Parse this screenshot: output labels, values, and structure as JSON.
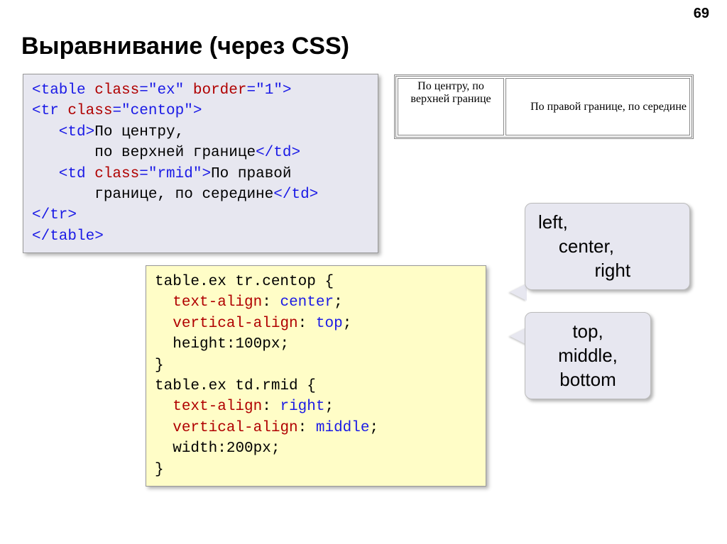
{
  "page_number": "69",
  "title": "Выравнивание (через CSS)",
  "html_code": {
    "l1": {
      "a": "<table ",
      "b": "class",
      "c": "=",
      "d": "\"ex\"",
      "e": " ",
      "f": "border",
      "g": "=",
      "h": "\"1\"",
      "i": ">"
    },
    "l2": {
      "a": "<tr ",
      "b": "class",
      "c": "=",
      "d": "\"centop\"",
      "e": ">"
    },
    "l3": {
      "a": "   <td>",
      "b": "По центру,"
    },
    "l4": {
      "a": "       по верхней границе",
      "b": "</td>"
    },
    "l5": {
      "a": "   <td ",
      "b": "class",
      "c": "=",
      "d": "\"rmid\"",
      "e": ">",
      "f": "По правой"
    },
    "l6": {
      "a": "       границе, по середине",
      "b": "</td>"
    },
    "l7": {
      "a": "</tr>"
    },
    "l8": {
      "a": "</table>"
    }
  },
  "css_code": {
    "l1": "table.ex tr.centop {",
    "l2a": "  ",
    "l2b": "text-align",
    "l2c": ": ",
    "l2d": "center",
    "l2e": ";",
    "l3a": "  ",
    "l3b": "vertical-align",
    "l3c": ": ",
    "l3d": "top",
    "l3e": ";",
    "l4a": "  ",
    "l4b": "height",
    "l4c": ":",
    "l4d": "100px",
    "l4e": ";",
    "l5": "}",
    "l6": "table.ex td.rmid {",
    "l7a": "  ",
    "l7b": "text-align",
    "l7c": ": ",
    "l7d": "right",
    "l7e": ";",
    "l8a": "  ",
    "l8b": "vertical-align",
    "l8c": ": ",
    "l8d": "middle",
    "l8e": ";",
    "l9a": "  ",
    "l9b": "width",
    "l9c": ":",
    "l9d": "200px",
    "l9e": ";",
    "l10": "}"
  },
  "example": {
    "cell1": "По центру, по\nверхней\nгранице",
    "cell2": "По правой границе, по\nсередине"
  },
  "callout1": "left,\n    center,\n           right",
  "callout2": "top,\nmiddle,\nbottom"
}
